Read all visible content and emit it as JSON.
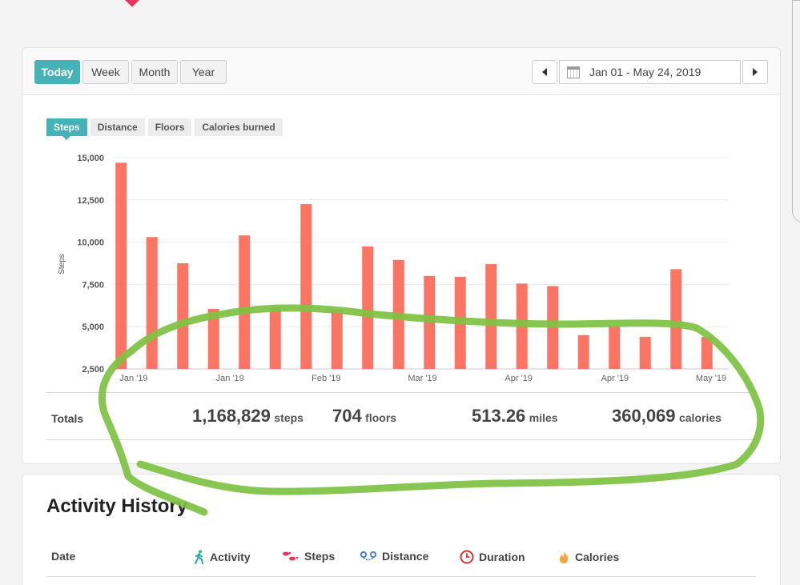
{
  "toolbar": {
    "ranges": [
      "Today",
      "Week",
      "Month",
      "Year"
    ],
    "active_range": "Today",
    "date_range": "Jan 01 - May 24, 2019"
  },
  "metric_tabs": [
    "Steps",
    "Distance",
    "Floors",
    "Calories burned"
  ],
  "active_metric": "Steps",
  "chart_data": {
    "type": "bar",
    "ylabel": "Steps",
    "ylim": [
      2500,
      15000
    ],
    "yticks": [
      "15,000",
      "12,500",
      "10,000",
      "7,500",
      "5,000",
      "2,500"
    ],
    "xtick_labels": [
      "Jan '19",
      "Jan '19",
      "Feb '19",
      "Mar '19",
      "Apr '19",
      "Apr '19",
      "May '19"
    ],
    "values": [
      14700,
      10300,
      8750,
      6050,
      10400,
      6150,
      12250,
      6000,
      9750,
      8950,
      8000,
      7950,
      8700,
      7550,
      7400,
      4500,
      5050,
      4400,
      8400,
      4400
    ],
    "bar_color": "#fa7564",
    "grid": true
  },
  "totals": {
    "label": "Totals",
    "steps": {
      "value": "1,168,829",
      "unit": "steps"
    },
    "floors": {
      "value": "704",
      "unit": "floors"
    },
    "miles": {
      "value": "513.26",
      "unit": "miles"
    },
    "calories": {
      "value": "360,069",
      "unit": "calories"
    }
  },
  "history": {
    "title": "Activity History",
    "columns": [
      "Date",
      "Activity",
      "Steps",
      "Distance",
      "Duration",
      "Calories"
    ]
  },
  "colors": {
    "accent": "#45b2b7",
    "bar": "#fa7564",
    "annotation": "#7dc242"
  }
}
